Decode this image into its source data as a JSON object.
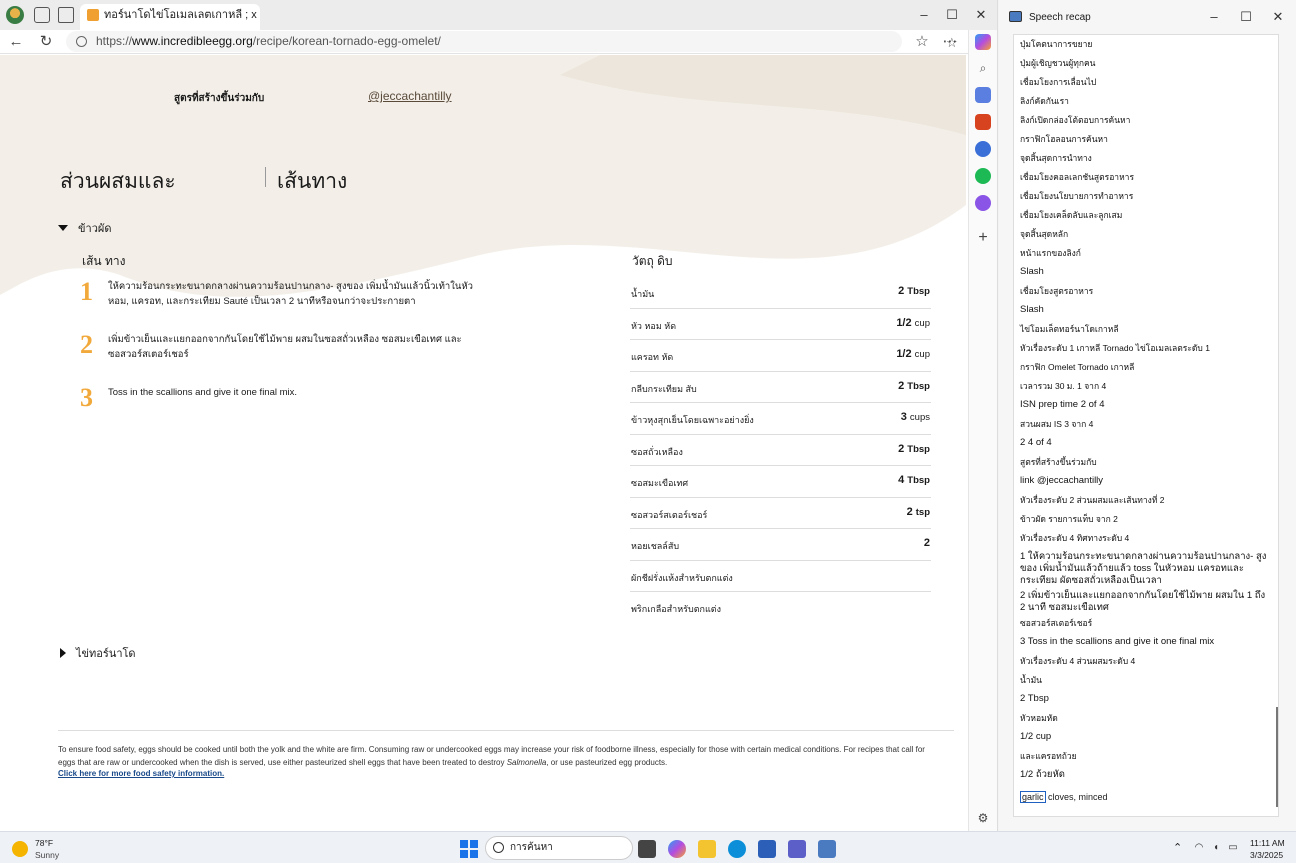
{
  "browser": {
    "tab_title": "ทอร์นาโดไข่โอเมลเลตเกาหลี ; x +",
    "url_prefix": "https://",
    "url_host": "www.incredibleegg.org",
    "url_path": "/recipe/korean-tornado-egg-omelet/"
  },
  "page": {
    "contributor_label": "สูตรที่สร้างขึ้นร่วมกับ",
    "contributor_link": "@jeccachantilly",
    "tab_ingredients": "ส่วนผสมและ",
    "tab_directions": "เส้นทาง",
    "section1_title": "ข้าวผัด",
    "section2_title": "ไข่ทอร์นาโด",
    "steps_heading": "เส้น ทาง",
    "steps": [
      {
        "num": "1",
        "text": "ให้ความร้อนกระทะขนาดกลางผ่านความร้อนปานกลาง- สูงของ เพิ่มน้ำมันแล้วนิ้วเท้าในหัวหอม, แครอท, และกระเทียม Sauté เป็นเวลา 2 นาทีหรือจนกว่าจะประกายตา"
      },
      {
        "num": "2",
        "text": "เพิ่มข้าวเย็นและแยกออกจากกันโดยใช้ไม้พาย ผสมในซอสถั่วเหลือง ซอสมะเขือเทศ และ ซอสวอร์สเตอร์เชอร์"
      },
      {
        "num": "3",
        "text": "Toss in the scallions and give it one final mix."
      }
    ],
    "ingredients_heading": "วัตถุ ดิบ",
    "ingredients": [
      {
        "name": "น้ำมัน",
        "qty": "2",
        "unit": "Tbsp"
      },
      {
        "name": "หัว หอม หัด",
        "qty": "1/2",
        "unit": "cup"
      },
      {
        "name": "แครอท หัด",
        "qty": "1/2",
        "unit": "cup"
      },
      {
        "name": "กลีบกระเทียม สับ",
        "qty": "2",
        "unit": "Tbsp"
      },
      {
        "name": "ข้าวหุงสุกเย็นโดยเฉพาะอย่างยิ่ง",
        "qty": "3",
        "unit": "cups"
      },
      {
        "name": "ซอสถั่วเหลือง",
        "qty": "2",
        "unit": "Tbsp"
      },
      {
        "name": "ซอสมะเขือเทศ",
        "qty": "4",
        "unit": "Tbsp"
      },
      {
        "name": "ซอสวอร์สเตอร์เชอร์",
        "qty": "2",
        "unit": "tsp"
      },
      {
        "name": "หอยเชลล์สับ",
        "qty": "2",
        "unit": ""
      },
      {
        "name": "ผักชีฝรั่งแห้งสำหรับตกแต่ง",
        "qty": "",
        "unit": ""
      },
      {
        "name": "พริกเกลือสำหรับตกแต่ง",
        "qty": "",
        "unit": ""
      }
    ],
    "footer_text_1": "To ensure food safety, eggs should be cooked until both the yolk and the white are firm. Consuming raw or undercooked eggs may increase your risk of foodborne illness, especially for those with certain medical conditions. For recipes that call for eggs that are raw or undercooked when the dish is served, use either pasteurized shell eggs that have been treated to destroy ",
    "footer_italic": "Salmonella",
    "footer_text_2": ", or use pasteurized egg products.",
    "footer_link": "Click here for more food safety information."
  },
  "recap": {
    "title": "Speech recap",
    "lines": [
      "ปุ่มโคตนาการขยาย",
      "ปุ่มผู้เชิญชวนผู้ทุกคน",
      "เชื่อมโยงการเลื่อนไป",
      "ลิงก์คัดกันเรา",
      "ลิงก์เปิดกล่องโต้ตอบการค้นหา",
      "กราฟิกโฮลอนการค้นหา",
      "จุดสิ้นสุดการนำทาง",
      "เชื่อมโยงคอลเลกชันสูตรอาหาร",
      "เชื่อมโยงนโยบายการทำอาหาร",
      "เชื่อมโยงเคล็ดลับและลูกเสม",
      "จุดสิ้นสุดหลัก",
      "หน้าแรกของลิงก์",
      "Slash",
      "เชื่อมโยงสูตรอาหาร",
      "Slash",
      "ไข่โอมเล็ตทอร์นาโดเกาหลี",
      "หัวเรื่องระดับ 1 เกาหลี Tornado ไข่โอเมลเลตระดับ 1",
      "กราฟิก Omelet Tornado เกาหลี",
      "เวลารวม 30 ม. 1 จาก 4",
      "ISN prep time 2 of 4",
      "สวนผสม IS 3 จาก 4",
      "2 4 of 4",
      "สูตรที่สร้างขึ้นร่วมกับ",
      "link @jeccachantilly",
      "หัวเรื่องระดับ 2 ส่วนผสมและเส้นทางที่ 2",
      "ข้าวผัด รายการแท็บ จาก 2",
      "หัวเรื่องระดับ 4 ทิศทางระดับ 4",
      "1 ให้ความร้อนกระทะขนาดกลางผ่านความร้อนปานกลาง- สูงของ เพิ่มน้ำมันแล้วถ้ายแล้ว toss ในหัวหอม แครอทและกระเทียม ผัดซอสถั่วเหลืองเป็นเวลา",
      "2 เพิ่มข้าวเย็นและแยกออกจากกันโดยใช้ไม้พาย ผสมใน 1 ถึง 2 นาที ซอสมะเขือเทศ",
      "ซอสวอร์สเตอร์เชอร์",
      "3 Toss in the scallions and give it one final mix",
      "หัวเรื่องระดับ 4 ส่วนผสมระดับ 4",
      "น้ำมัน",
      "2 Tbsp",
      "หัวหอมหัด",
      "1/2 cup",
      "และแครอทถ้วย",
      "1/2 ถ้วยหัด"
    ],
    "last_highlight": "garlic",
    "last_rest": " cloves, minced"
  },
  "taskbar": {
    "weather_temp": "78°F",
    "weather_desc": "Sunny",
    "search_text": "การค้นหา",
    "time": "11:11 AM",
    "date": "3/3/2025"
  },
  "colors": {
    "step_number": "#f2a93b",
    "link": "#1a4a8a",
    "windows_blue": "#1a73e8"
  }
}
